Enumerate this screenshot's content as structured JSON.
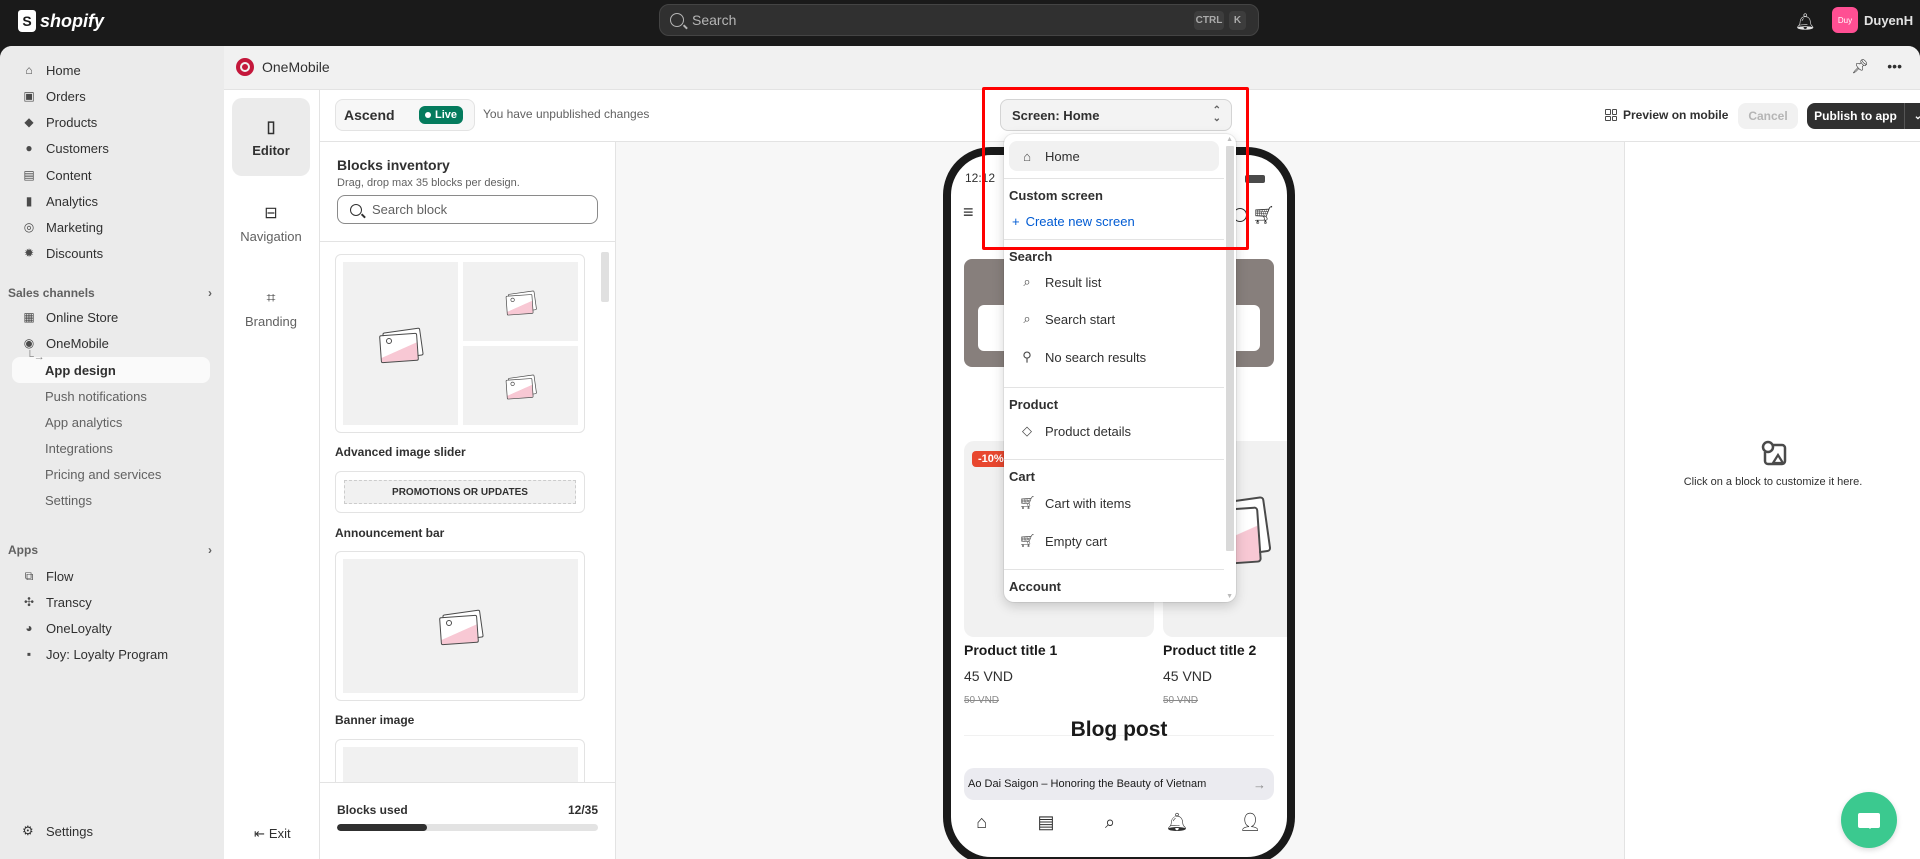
{
  "topbar": {
    "brand": "shopify",
    "search_placeholder": "Search",
    "shortcut_keys": [
      "CTRL",
      "K"
    ],
    "user_initials": "Duy",
    "user_name": "DuyenH",
    "avatar_color": "#ff4f93"
  },
  "sidebar": {
    "items": [
      {
        "label": "Home",
        "icon": "home-icon"
      },
      {
        "label": "Orders",
        "icon": "orders-icon"
      },
      {
        "label": "Products",
        "icon": "tag-icon"
      },
      {
        "label": "Customers",
        "icon": "person-icon"
      },
      {
        "label": "Content",
        "icon": "content-icon"
      },
      {
        "label": "Analytics",
        "icon": "bar-chart-icon"
      },
      {
        "label": "Marketing",
        "icon": "target-icon"
      },
      {
        "label": "Discounts",
        "icon": "discount-icon"
      }
    ],
    "sales_channels_label": "Sales channels",
    "channels": [
      {
        "label": "Online Store",
        "icon": "store-icon"
      },
      {
        "label": "OneMobile",
        "icon": "onemobile-icon"
      }
    ],
    "onemobile_sub": [
      {
        "label": "App design",
        "active": true
      },
      {
        "label": "Push notifications"
      },
      {
        "label": "App analytics"
      },
      {
        "label": "Integrations"
      },
      {
        "label": "Pricing and services"
      },
      {
        "label": "Settings"
      }
    ],
    "apps_label": "Apps",
    "apps": [
      {
        "label": "Flow",
        "icon": "flow-icon"
      },
      {
        "label": "Transcy",
        "icon": "transcy-icon"
      },
      {
        "label": "OneLoyalty",
        "icon": "oneloyalty-icon"
      },
      {
        "label": "Joy: Loyalty Program",
        "icon": "joy-icon"
      }
    ],
    "settings_label": "Settings"
  },
  "appbar": {
    "title": "OneMobile",
    "brand_color": "#c4173b"
  },
  "rail": {
    "items": [
      {
        "label": "Editor",
        "icon": "phone-icon",
        "active": true
      },
      {
        "label": "Navigation",
        "icon": "navigation-icon"
      },
      {
        "label": "Branding",
        "icon": "branding-icon"
      }
    ],
    "exit_label": "Exit"
  },
  "designbar": {
    "theme_name": "Ascend",
    "live_badge": "Live",
    "live_color": "#047b5d",
    "unpublished_text": "You have unpublished changes",
    "screen_selector": "Screen: Home",
    "preview_label": "Preview on mobile",
    "cancel_label": "Cancel",
    "publish_label": "Publish to app"
  },
  "inventory": {
    "title": "Blocks inventory",
    "subtitle": "Drag, drop max 35 blocks per design.",
    "search_placeholder": "Search block",
    "blocks": [
      {
        "label": "Advanced image slider"
      },
      {
        "label": "Announcement bar",
        "preview_text": "PROMOTIONS OR UPDATES"
      },
      {
        "label": "Banner image"
      },
      {
        "label": ""
      }
    ],
    "used_label": "Blocks used",
    "used_count": "12/35",
    "used_fraction": 0.343
  },
  "phone": {
    "time": "12:12",
    "products": [
      {
        "title": "Product title 1",
        "price": "45 VND",
        "old_price": "50 VND",
        "badge": "-10%"
      },
      {
        "title": "Product title 2",
        "price": "45 VND",
        "old_price": "50 VND"
      }
    ],
    "blog_heading": "Blog post",
    "blog_item": "Ao Dai Saigon – Honoring the Beauty of Vietnam",
    "tabbar": [
      "home-icon",
      "news-icon",
      "search-list-icon",
      "bell-icon",
      "user-icon"
    ]
  },
  "dropdown": {
    "selected": "Home",
    "custom_section": "Custom screen",
    "create_label": "Create new screen",
    "sections": [
      {
        "title": "Search",
        "items": [
          "Result list",
          "Search start",
          "No search results"
        ]
      },
      {
        "title": "Product",
        "items": [
          "Product details"
        ]
      },
      {
        "title": "Cart",
        "items": [
          "Cart with items",
          "Empty cart"
        ]
      },
      {
        "title": "Account",
        "items": []
      }
    ],
    "link_color": "#005bd3"
  },
  "right_panel": {
    "message": "Click on a block to customize it here."
  },
  "annotation": {
    "highlight_color": "#ff0000"
  }
}
